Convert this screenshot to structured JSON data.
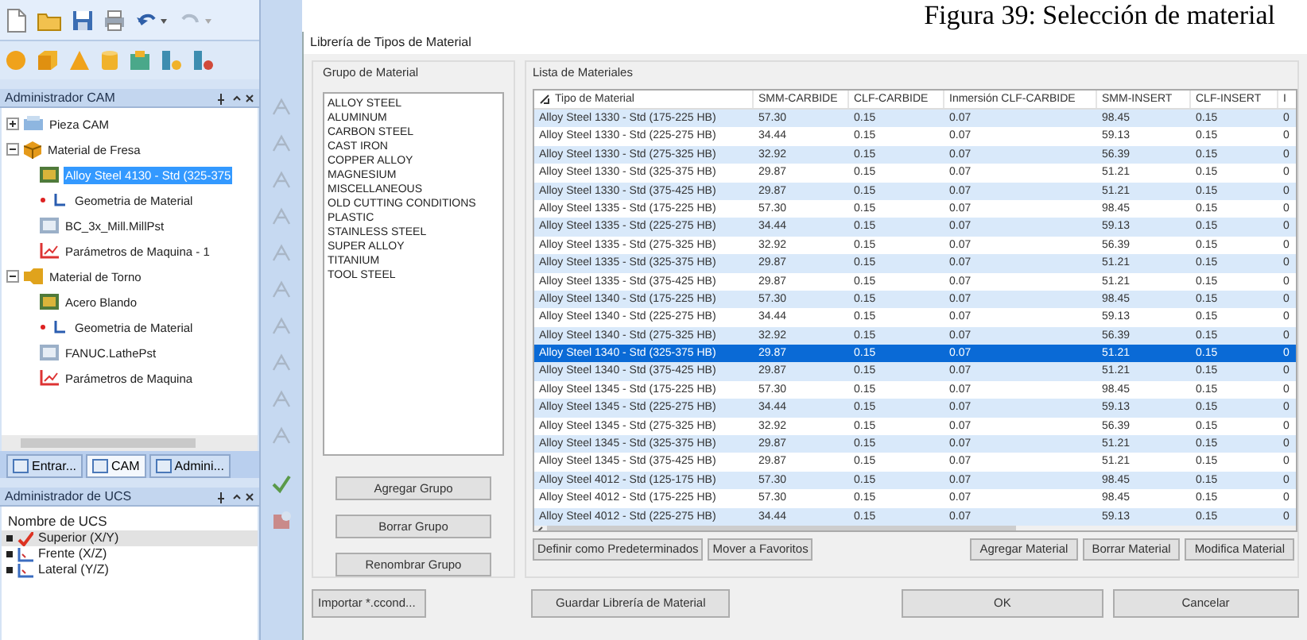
{
  "caption": "Figura 39: Selección de material",
  "cam_manager": {
    "title": "Administrador CAM",
    "tree": [
      {
        "label": "Pieza CAM",
        "kind": "part",
        "expanded": false,
        "selected": false
      },
      {
        "label": "Material de Fresa",
        "kind": "mill",
        "expanded": true,
        "selected": false,
        "children": [
          {
            "label": "Alloy Steel 4130 - Std (325-375",
            "kind": "stock",
            "selected": true
          },
          {
            "label": "Geometria de Material",
            "kind": "geometry",
            "selected": false
          },
          {
            "label": "BC_3x_Mill.MillPst",
            "kind": "post",
            "selected": false
          },
          {
            "label": "Parámetros de Maquina - 1",
            "kind": "params",
            "selected": false
          }
        ]
      },
      {
        "label": "Material de Torno",
        "kind": "lathe",
        "expanded": true,
        "selected": false,
        "children": [
          {
            "label": "Acero Blando",
            "kind": "stock",
            "selected": false
          },
          {
            "label": "Geometria de Material",
            "kind": "geometry",
            "selected": false
          },
          {
            "label": "FANUC.LathePst",
            "kind": "post",
            "selected": false
          },
          {
            "label": "Parámetros de Maquina",
            "kind": "params",
            "selected": false
          }
        ]
      }
    ],
    "tabs": [
      {
        "label": "Entrar...",
        "selected": false
      },
      {
        "label": "CAM",
        "selected": true
      },
      {
        "label": "Admini...",
        "selected": false
      }
    ]
  },
  "ucs_manager": {
    "title": "Administrador de UCS",
    "header": "Nombre de UCS",
    "items": [
      {
        "label": "Superior (X/Y)",
        "selected": true
      },
      {
        "label": "Frente (X/Z)",
        "selected": false
      },
      {
        "label": "Lateral (Y/Z)",
        "selected": false
      }
    ]
  },
  "dialog": {
    "title": "Librería de Tipos de Material",
    "group": {
      "title": "Grupo de Material",
      "items": [
        "ALLOY STEEL",
        "ALUMINUM",
        "CARBON STEEL",
        "CAST IRON",
        "COPPER ALLOY",
        "MAGNESIUM",
        "MISCELLANEOUS",
        "OLD CUTTING CONDITIONS",
        "PLASTIC",
        "STAINLESS STEEL",
        "SUPER ALLOY",
        "TITANIUM",
        "TOOL STEEL"
      ],
      "buttons": [
        "Agregar Grupo",
        "Borrar Grupo",
        "Renombrar Grupo"
      ]
    },
    "materials": {
      "title": "Lista de Materiales",
      "columns": [
        "Tipo de Material",
        "SMM-CARBIDE",
        "CLF-CARBIDE",
        "Inmersión CLF-CARBIDE",
        "SMM-INSERT",
        "CLF-INSERT",
        "I"
      ],
      "rows": [
        {
          "cells": [
            "Alloy Steel 1330 - Std (175-225 HB)",
            "57.30",
            "0.15",
            "0.07",
            "98.45",
            "0.15",
            "0"
          ],
          "selected": false
        },
        {
          "cells": [
            "Alloy Steel 1330 - Std (225-275 HB)",
            "34.44",
            "0.15",
            "0.07",
            "59.13",
            "0.15",
            "0"
          ],
          "selected": false
        },
        {
          "cells": [
            "Alloy Steel 1330 - Std (275-325 HB)",
            "32.92",
            "0.15",
            "0.07",
            "56.39",
            "0.15",
            "0"
          ],
          "selected": false
        },
        {
          "cells": [
            "Alloy Steel 1330 - Std (325-375 HB)",
            "29.87",
            "0.15",
            "0.07",
            "51.21",
            "0.15",
            "0"
          ],
          "selected": false
        },
        {
          "cells": [
            "Alloy Steel 1330 - Std (375-425 HB)",
            "29.87",
            "0.15",
            "0.07",
            "51.21",
            "0.15",
            "0"
          ],
          "selected": false
        },
        {
          "cells": [
            "Alloy Steel 1335 - Std (175-225 HB)",
            "57.30",
            "0.15",
            "0.07",
            "98.45",
            "0.15",
            "0"
          ],
          "selected": false
        },
        {
          "cells": [
            "Alloy Steel 1335 - Std (225-275 HB)",
            "34.44",
            "0.15",
            "0.07",
            "59.13",
            "0.15",
            "0"
          ],
          "selected": false
        },
        {
          "cells": [
            "Alloy Steel 1335 - Std (275-325 HB)",
            "32.92",
            "0.15",
            "0.07",
            "56.39",
            "0.15",
            "0"
          ],
          "selected": false
        },
        {
          "cells": [
            "Alloy Steel 1335 - Std (325-375 HB)",
            "29.87",
            "0.15",
            "0.07",
            "51.21",
            "0.15",
            "0"
          ],
          "selected": false
        },
        {
          "cells": [
            "Alloy Steel 1335 - Std (375-425 HB)",
            "29.87",
            "0.15",
            "0.07",
            "51.21",
            "0.15",
            "0"
          ],
          "selected": false
        },
        {
          "cells": [
            "Alloy Steel 1340 - Std (175-225 HB)",
            "57.30",
            "0.15",
            "0.07",
            "98.45",
            "0.15",
            "0"
          ],
          "selected": false
        },
        {
          "cells": [
            "Alloy Steel 1340 - Std (225-275 HB)",
            "34.44",
            "0.15",
            "0.07",
            "59.13",
            "0.15",
            "0"
          ],
          "selected": false
        },
        {
          "cells": [
            "Alloy Steel 1340 - Std (275-325 HB)",
            "32.92",
            "0.15",
            "0.07",
            "56.39",
            "0.15",
            "0"
          ],
          "selected": false
        },
        {
          "cells": [
            "Alloy Steel 1340 - Std (325-375 HB)",
            "29.87",
            "0.15",
            "0.07",
            "51.21",
            "0.15",
            "0"
          ],
          "selected": true
        },
        {
          "cells": [
            "Alloy Steel 1340 - Std (375-425 HB)",
            "29.87",
            "0.15",
            "0.07",
            "51.21",
            "0.15",
            "0"
          ],
          "selected": false
        },
        {
          "cells": [
            "Alloy Steel 1345 - Std (175-225 HB)",
            "57.30",
            "0.15",
            "0.07",
            "98.45",
            "0.15",
            "0"
          ],
          "selected": false
        },
        {
          "cells": [
            "Alloy Steel 1345 - Std (225-275 HB)",
            "34.44",
            "0.15",
            "0.07",
            "59.13",
            "0.15",
            "0"
          ],
          "selected": false
        },
        {
          "cells": [
            "Alloy Steel 1345 - Std (275-325 HB)",
            "32.92",
            "0.15",
            "0.07",
            "56.39",
            "0.15",
            "0"
          ],
          "selected": false
        },
        {
          "cells": [
            "Alloy Steel 1345 - Std (325-375 HB)",
            "29.87",
            "0.15",
            "0.07",
            "51.21",
            "0.15",
            "0"
          ],
          "selected": false
        },
        {
          "cells": [
            "Alloy Steel 1345 - Std (375-425 HB)",
            "29.87",
            "0.15",
            "0.07",
            "51.21",
            "0.15",
            "0"
          ],
          "selected": false
        },
        {
          "cells": [
            "Alloy Steel 4012 - Std (125-175 HB)",
            "57.30",
            "0.15",
            "0.07",
            "98.45",
            "0.15",
            "0"
          ],
          "selected": false
        },
        {
          "cells": [
            "Alloy Steel 4012 - Std (175-225 HB)",
            "57.30",
            "0.15",
            "0.07",
            "98.45",
            "0.15",
            "0"
          ],
          "selected": false
        },
        {
          "cells": [
            "Alloy Steel 4012 - Std (225-275 HB)",
            "34.44",
            "0.15",
            "0.07",
            "59.13",
            "0.15",
            "0"
          ],
          "selected": false
        }
      ],
      "left_buttons": [
        "Definir como Predeterminados",
        "Mover a Favoritos"
      ],
      "right_buttons": [
        "Agregar Material",
        "Borrar Material",
        "Modifica Material"
      ]
    },
    "footer_buttons": [
      "Importar *.ccond...",
      "Guardar Librería de Material",
      "OK",
      "Cancelar"
    ]
  }
}
